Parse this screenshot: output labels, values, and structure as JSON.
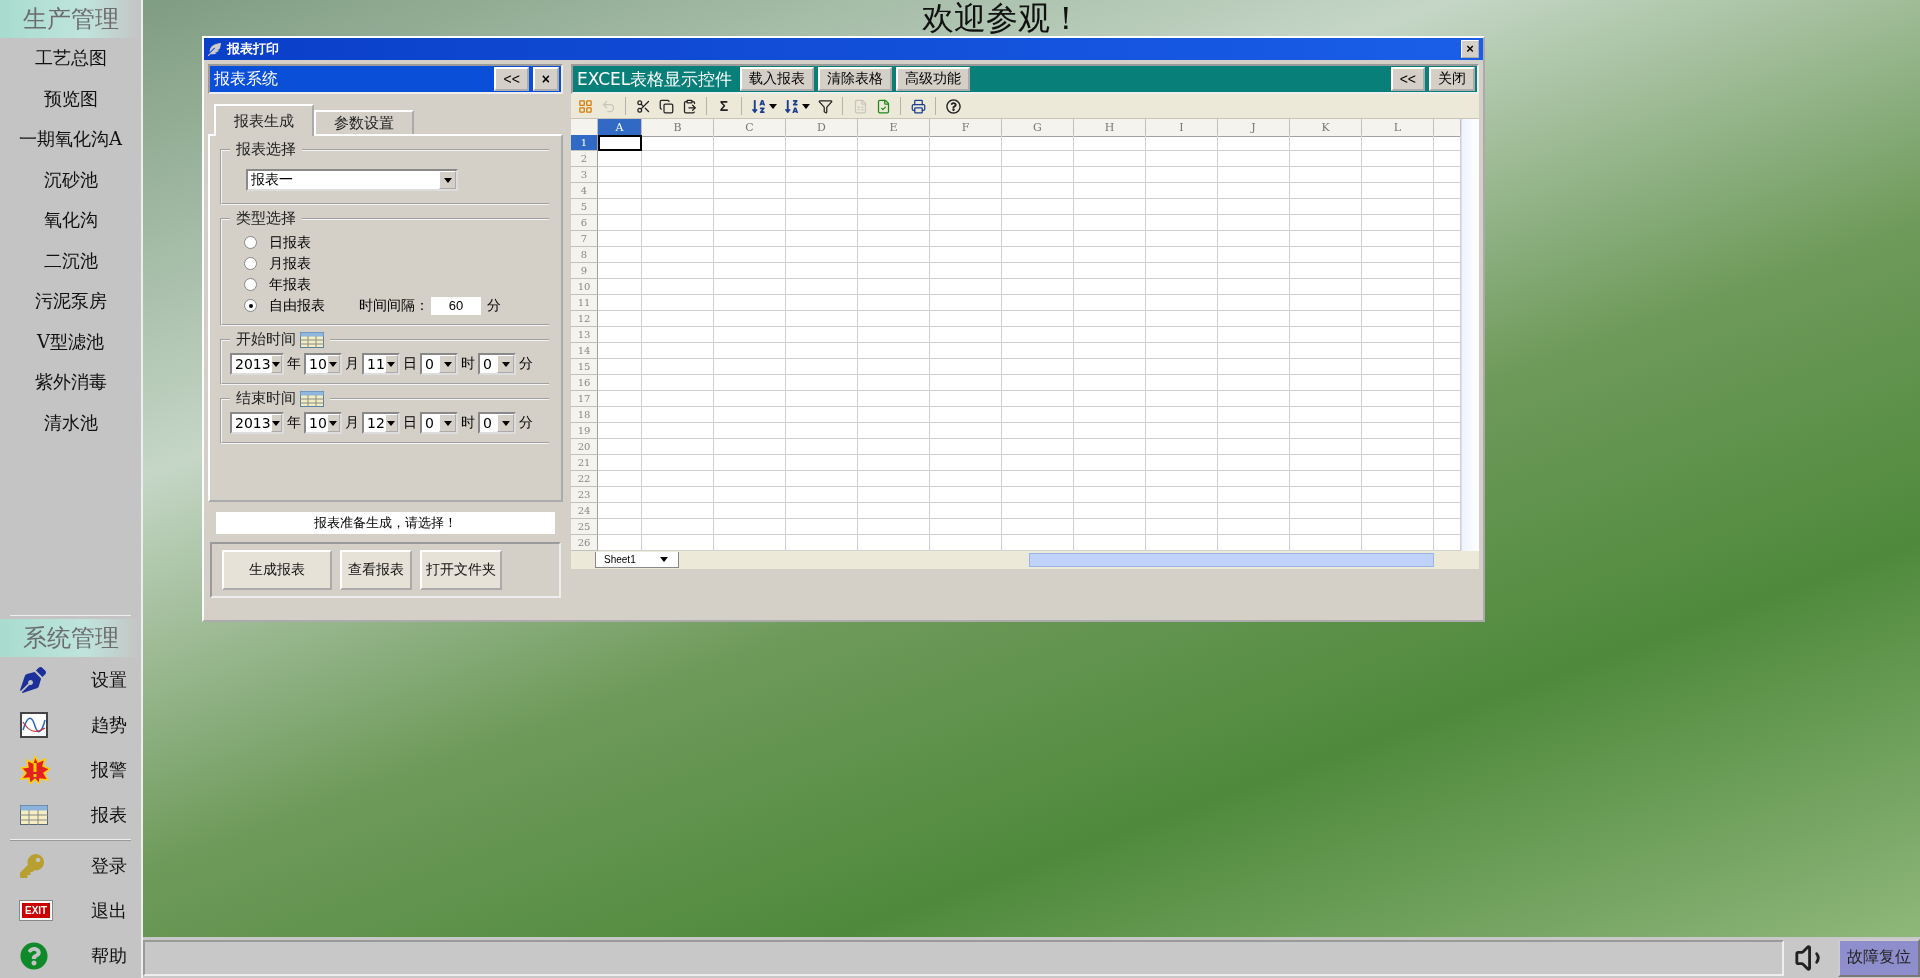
{
  "sidebar": {
    "production": {
      "title": "生产管理",
      "items": [
        "工艺总图",
        "预览图",
        "一期氧化沟A",
        "沉砂池",
        "氧化沟",
        "二沉池",
        "污泥泵房",
        "V型滤池",
        "紫外消毒",
        "清水池"
      ]
    },
    "system": {
      "title": "系统管理",
      "groups": [
        [
          {
            "kind": "pen",
            "label": "设置"
          },
          {
            "kind": "trend",
            "label": "趋势"
          },
          {
            "kind": "alarm",
            "label": "报警"
          },
          {
            "kind": "table",
            "label": "报表"
          }
        ],
        [
          {
            "kind": "keys",
            "label": "登录"
          },
          {
            "kind": "exit",
            "label": "退出",
            "badge": "EXIT"
          },
          {
            "kind": "help",
            "label": "帮助"
          }
        ]
      ]
    }
  },
  "banner": "欢迎参观！",
  "dialog": {
    "title": "报表打印",
    "close": "×",
    "left": {
      "title": "报表系统",
      "buttons": [
        "<<",
        "×"
      ],
      "tabs": [
        {
          "label": "报表生成",
          "selected": true
        },
        {
          "label": "参数设置",
          "selected": false
        }
      ],
      "report_select": {
        "legend": "报表选择",
        "value": "报表一"
      },
      "type_select": {
        "legend": "类型选择",
        "options": [
          {
            "label": "日报表",
            "selected": false
          },
          {
            "label": "月报表",
            "selected": false
          },
          {
            "label": "年报表",
            "selected": false
          },
          {
            "label": "自由报表",
            "selected": true
          }
        ],
        "interval_label": "时间间隔：",
        "interval_value": "60",
        "interval_unit": "分"
      },
      "times": [
        {
          "legend": "开始时间",
          "fields": [
            {
              "value": "2013",
              "unit": "年"
            },
            {
              "value": "10",
              "unit": "月"
            },
            {
              "value": "11",
              "unit": "日"
            },
            {
              "value": "0",
              "unit": "时"
            },
            {
              "value": "0",
              "unit": "分"
            }
          ]
        },
        {
          "legend": "结束时间",
          "fields": [
            {
              "value": "2013",
              "unit": "年"
            },
            {
              "value": "10",
              "unit": "月"
            },
            {
              "value": "12",
              "unit": "日"
            },
            {
              "value": "0",
              "unit": "时"
            },
            {
              "value": "0",
              "unit": "分"
            }
          ]
        }
      ],
      "status": "报表准备生成，请选择！",
      "actions": [
        "生成报表",
        "查看报表",
        "打开文件夹"
      ]
    },
    "right": {
      "title": "EXCEL表格显示控件",
      "buttons": [
        "载入报表",
        "清除表格",
        "高级功能"
      ],
      "right_buttons": [
        "<<",
        "关闭"
      ],
      "toolbar": [
        {
          "kind": "insert",
          "disabled": false
        },
        {
          "kind": "undo",
          "disabled": true
        },
        {
          "kind": "separator"
        },
        {
          "kind": "cut",
          "disabled": false
        },
        {
          "kind": "copy",
          "disabled": false
        },
        {
          "kind": "paste",
          "disabled": false
        },
        {
          "kind": "separator"
        },
        {
          "kind": "sum",
          "label": "Σ",
          "disabled": false
        },
        {
          "kind": "separator"
        },
        {
          "kind": "sortasc",
          "disabled": false
        },
        {
          "kind": "sortdesc",
          "disabled": false
        },
        {
          "kind": "filter",
          "disabled": false
        },
        {
          "kind": "separator"
        },
        {
          "kind": "sheet",
          "disabled": true
        },
        {
          "kind": "export",
          "disabled": false
        },
        {
          "kind": "separator"
        },
        {
          "kind": "preview",
          "disabled": false
        },
        {
          "kind": "separator"
        },
        {
          "kind": "help",
          "disabled": false
        }
      ],
      "columns": [
        {
          "label": "A",
          "selected": true
        },
        {
          "label": "B",
          "selected": false
        },
        {
          "label": "C",
          "selected": false
        },
        {
          "label": "D",
          "selected": false
        },
        {
          "label": "E",
          "selected": false
        },
        {
          "label": "F",
          "selected": false
        },
        {
          "label": "G",
          "selected": false
        },
        {
          "label": "H",
          "selected": false
        },
        {
          "label": "I",
          "selected": false
        },
        {
          "label": "J",
          "selected": false
        },
        {
          "label": "K",
          "selected": false
        },
        {
          "label": "L",
          "selected": false
        }
      ],
      "rows": [
        {
          "label": "1",
          "selected": true
        },
        {
          "label": "2",
          "selected": false
        },
        {
          "label": "3",
          "selected": false
        },
        {
          "label": "4",
          "selected": false
        },
        {
          "label": "5",
          "selected": false
        },
        {
          "label": "6",
          "selected": false
        },
        {
          "label": "7",
          "selected": false
        },
        {
          "label": "8",
          "selected": false
        },
        {
          "label": "9",
          "selected": false
        },
        {
          "label": "10",
          "selected": false
        },
        {
          "label": "11",
          "selected": false
        },
        {
          "label": "12",
          "selected": false
        },
        {
          "label": "13",
          "selected": false
        },
        {
          "label": "14",
          "selected": false
        },
        {
          "label": "15",
          "selected": false
        },
        {
          "label": "16",
          "selected": false
        },
        {
          "label": "17",
          "selected": false
        },
        {
          "label": "18",
          "selected": false
        },
        {
          "label": "19",
          "selected": false
        },
        {
          "label": "20",
          "selected": false
        },
        {
          "label": "21",
          "selected": false
        },
        {
          "label": "22",
          "selected": false
        },
        {
          "label": "23",
          "selected": false
        },
        {
          "label": "24",
          "selected": false
        },
        {
          "label": "25",
          "selected": false
        },
        {
          "label": "26",
          "selected": false
        }
      ],
      "sheet_tabs": [
        "Sheet1"
      ]
    }
  },
  "status_bar": {
    "reset_button": "故障复位"
  }
}
